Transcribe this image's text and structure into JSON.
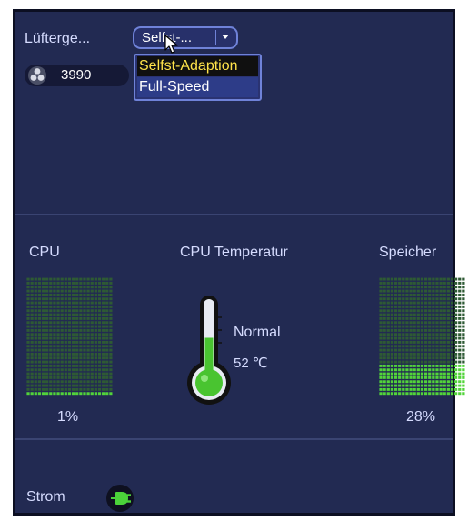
{
  "fan": {
    "label": "Lüfterge...",
    "mode_value": "Selfst-...",
    "options": [
      "Selfst-Adaption",
      "Full-Speed"
    ],
    "highlighted_option": "Selfst-Adaption",
    "speed": "3990"
  },
  "status": {
    "cpu_label": "CPU",
    "cpu_usage_text": "1%",
    "cpu_usage": 0.01,
    "temp_label": "CPU Temperatur",
    "temp_status": "Normal",
    "temp_value": "52 ℃",
    "temp_fill": 0.55,
    "mem_label": "Speicher",
    "mem_usage_text": "28%",
    "mem_usage": 0.28
  },
  "power": {
    "label": "Strom"
  },
  "colors": {
    "panel_bg": "#222a52",
    "meter_on": "#52d43a",
    "meter_off": "#2e5a34",
    "dropdown_highlight_text": "#ffe34a"
  },
  "icons": [
    "fan-icon",
    "chevron-down-icon",
    "mouse-cursor-icon",
    "thermometer-icon",
    "power-plug-icon"
  ]
}
